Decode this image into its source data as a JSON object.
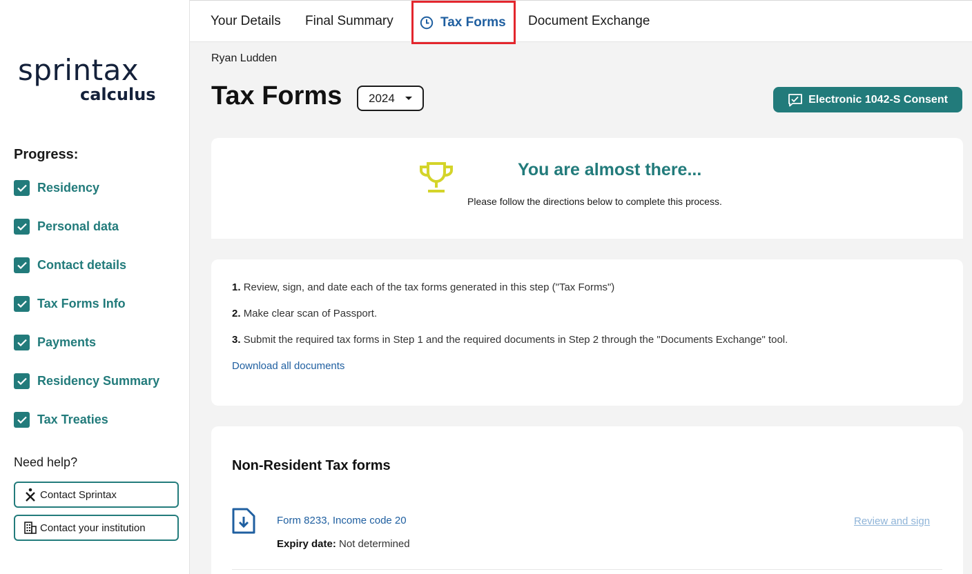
{
  "brand": {
    "word1": "sprintax",
    "word2": "calculus"
  },
  "nav": {
    "tabs": [
      {
        "label": "Your Details"
      },
      {
        "label": "Final Summary"
      },
      {
        "label": "Tax Forms",
        "active": true
      },
      {
        "label": "Document Exchange"
      }
    ]
  },
  "sidebar": {
    "progress_title": "Progress:",
    "items": [
      {
        "label": "Residency",
        "checked": true
      },
      {
        "label": "Personal data",
        "checked": true
      },
      {
        "label": "Contact details",
        "checked": true
      },
      {
        "label": "Tax Forms Info",
        "checked": true
      },
      {
        "label": "Payments",
        "checked": true
      },
      {
        "label": "Residency Summary",
        "checked": true
      },
      {
        "label": "Tax Treaties",
        "checked": true
      }
    ],
    "help_title": "Need help?",
    "contact_sprintax": "Contact Sprintax",
    "contact_institution": "Contact your institution"
  },
  "main": {
    "user_name": "Ryan Ludden",
    "page_title": "Tax Forms",
    "year": "2024",
    "consent_button": "Electronic 1042-S Consent",
    "almost": {
      "title": "You are almost there...",
      "subtitle": "Please follow the directions below to complete this process."
    },
    "steps": [
      {
        "num": "1.",
        "text": "Review, sign, and date each of the tax forms generated in this step (\"Tax Forms\")"
      },
      {
        "num": "2.",
        "text": "Make clear scan of Passport."
      },
      {
        "num": "3.",
        "text": "Submit the required tax forms in Step 1 and the required documents in Step 2 through the \"Documents Exchange\" tool."
      }
    ],
    "download_all": "Download all documents",
    "forms_section": {
      "title": "Non-Resident Tax forms",
      "forms": [
        {
          "name": "Form 8233, Income code 20",
          "expiry_label": "Expiry date:",
          "expiry_value": "Not determined",
          "action": "Review and sign"
        }
      ]
    }
  },
  "colors": {
    "teal": "#227b7b",
    "link_blue": "#1f5fa0",
    "highlight_red": "#e3262d",
    "trophy_yellow": "#d4d42a"
  }
}
